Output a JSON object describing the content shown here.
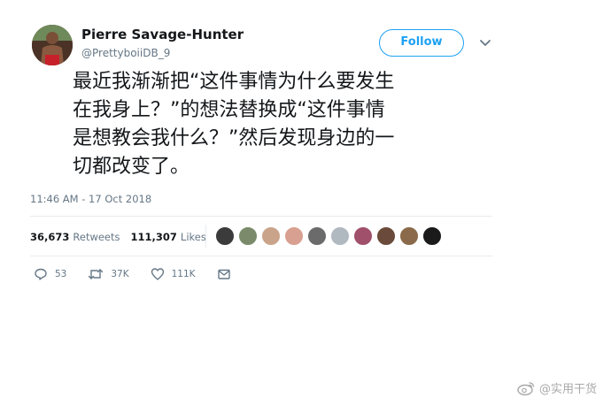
{
  "author": {
    "name": "Pierre Savage-Hunter",
    "handle": "@PrettyboiiDB_9"
  },
  "follow_label": "Follow",
  "tweet_lines": [
    "最近我渐渐把“这件事情为什么要发生",
    "在我身上？”的想法替换成“这件事情",
    "是想教会我什么？”然后发现身边的一",
    "切都改变了。"
  ],
  "timestamp": "11:46 AM - 17 Oct 2018",
  "stats": {
    "retweets_count": "36,673",
    "retweets_label": "Retweets",
    "likes_count": "111,307",
    "likes_label": "Likes"
  },
  "actions": {
    "reply_count": "53",
    "retweet_count": "37K",
    "like_count": "111K"
  },
  "liker_colors": [
    "#3b3b3b",
    "#7a8a6a",
    "#c9a48a",
    "#d8a090",
    "#6b6b6b",
    "#b0b8c0",
    "#a0506a",
    "#6a4a3a",
    "#8a6a4a",
    "#1a1a1a"
  ],
  "watermark_text": "@实用干货",
  "colors": {
    "accent": "#1da1f2",
    "muted": "#657786",
    "text": "#14171a"
  }
}
